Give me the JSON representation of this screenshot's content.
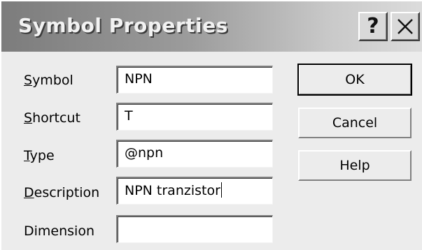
{
  "dialog": {
    "title": "Symbol Properties",
    "help_button": "?",
    "close_button": "close"
  },
  "fields": {
    "symbol": {
      "label_hotkey": "S",
      "label_rest": "ymbol",
      "value": "NPN"
    },
    "shortcut": {
      "label_hotkey": "S",
      "label_rest": "hortcut",
      "value": "T"
    },
    "type": {
      "label_hotkey": "T",
      "label_rest": "ype",
      "value": "@npn"
    },
    "description": {
      "label_hotkey": "D",
      "label_rest": "escription",
      "value": "NPN tranzistor"
    },
    "dimension": {
      "label": "Dimension",
      "value": ""
    }
  },
  "buttons": {
    "ok": "OK",
    "cancel": "Cancel",
    "help": "Help"
  },
  "colors": {
    "dialog_bg": "#ececec",
    "title_text": "#f2f2f2"
  }
}
